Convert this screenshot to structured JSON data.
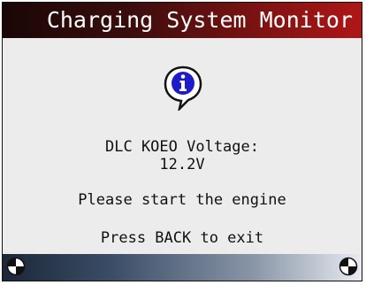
{
  "header": {
    "title": "Charging System Monitor"
  },
  "message": {
    "icon": "info-speech-bubble-icon",
    "voltage_label": "DLC KOEO Voltage:",
    "voltage_value": "12.2V",
    "instruction": "Please start the engine",
    "exit_hint": "Press BACK to exit"
  },
  "footer": {
    "left_icon": "circle-quadrant-icon",
    "right_icon": "circle-quadrant-icon"
  },
  "colors": {
    "title_bar_dark": "#1a0606",
    "title_bar_red": "#b01616",
    "content_bg": "#ececec",
    "info_icon_blue": "#1c1cc8",
    "footer_dark": "#1b2737"
  }
}
